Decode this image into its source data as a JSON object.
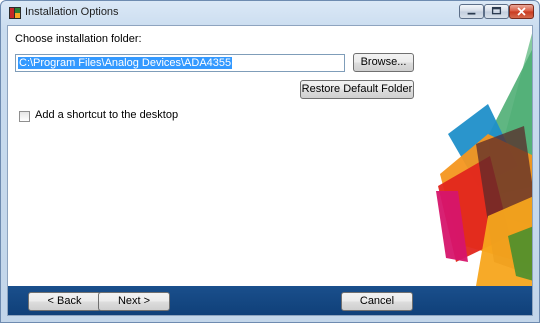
{
  "window": {
    "title": "Installation Options"
  },
  "folder": {
    "label": "Choose installation folder:",
    "path": "C:\\Program Files\\Analog Devices\\ADA4355",
    "browse_label": "Browse...",
    "restore_label": "Restore Default Folder"
  },
  "shortcut": {
    "label": "Add a shortcut to the desktop",
    "checked": false
  },
  "footer": {
    "back_label": "< Back",
    "next_label": "Next >",
    "cancel_label": "Cancel"
  },
  "icons": {
    "app": "installer-icon",
    "minimize": "minimize-icon",
    "maximize": "maximize-icon",
    "close": "close-icon"
  },
  "colors": {
    "footer": "#0f3f78",
    "selection": "#3399ff",
    "close_button": "#c9391f"
  }
}
